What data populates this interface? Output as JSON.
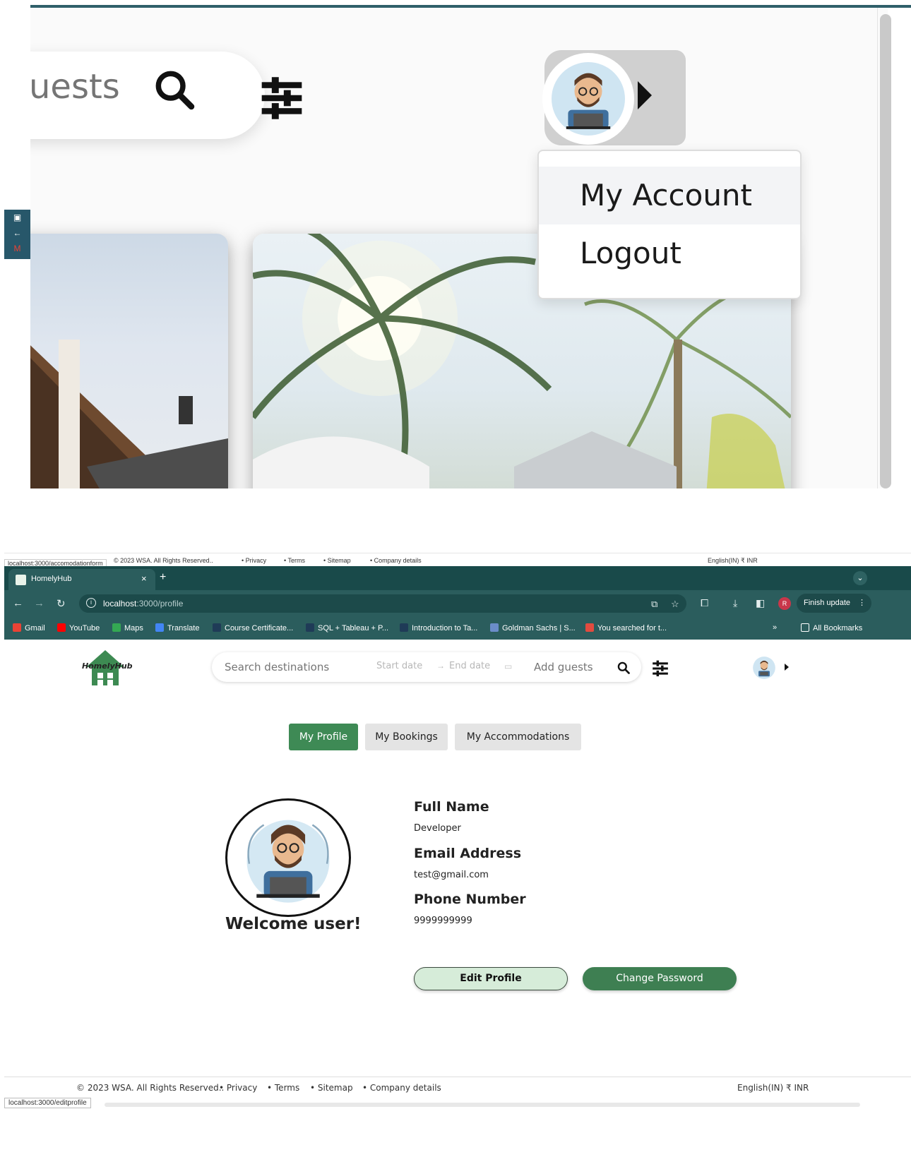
{
  "zoom": {
    "search_partial": "uests",
    "menu": {
      "items": [
        "My Account",
        "Logout"
      ]
    }
  },
  "ghost_footer": {
    "copyright": "© 2023 WSA. All Rights Reserved..",
    "links": [
      "• Privacy",
      "• Terms",
      "• Sitemap",
      "• Company details"
    ],
    "locale": "English(IN) ₹ INR",
    "url_hint": "localhost:3000/accomodationform"
  },
  "browser": {
    "tab_title": "HomelyHub",
    "tab_close": "×",
    "new_tab": "+",
    "url_host": "localhost",
    "url_path": ":3000/profile",
    "finish_update": "Finish update",
    "profile_initial": "R",
    "bookmarks": [
      {
        "label": "Gmail",
        "color": "#ea4335"
      },
      {
        "label": "YouTube",
        "color": "#ff0000"
      },
      {
        "label": "Maps",
        "color": "#34a853"
      },
      {
        "label": "Translate",
        "color": "#4285f4"
      },
      {
        "label": "Course Certificate...",
        "color": "#1f3b57"
      },
      {
        "label": "SQL + Tableau + P...",
        "color": "#1f3b57"
      },
      {
        "label": "Introduction to Ta...",
        "color": "#1f3b57"
      },
      {
        "label": "Goldman Sachs | S...",
        "color": "#6b8dc9"
      },
      {
        "label": "You searched for t...",
        "color": "#e24b3f"
      }
    ],
    "more_bookmarks": "»",
    "all_bookmarks": "All Bookmarks"
  },
  "app": {
    "logo_text": "HomelyHub",
    "search": {
      "destination_placeholder": "Search destinations",
      "start_placeholder": "Start date",
      "arrow": "→",
      "end_placeholder": "End date",
      "guests_placeholder": "Add guests"
    },
    "tabs": [
      "My Profile",
      "My Bookings",
      "My Accommodations"
    ],
    "active_tab": "My Profile",
    "welcome": "Welcome user!",
    "fields": [
      {
        "label": "Full Name",
        "value": "Developer"
      },
      {
        "label": "Email Address",
        "value": "test@gmail.com"
      },
      {
        "label": "Phone Number",
        "value": "9999999999"
      }
    ],
    "buttons": {
      "edit": "Edit Profile",
      "change_password": "Change Password"
    }
  },
  "footer": {
    "copyright": "© 2023 WSA. All Rights Reserved..",
    "links": [
      "• Privacy",
      "• Terms",
      "• Sitemap",
      "• Company details"
    ],
    "locale": "English(IN) ₹ INR",
    "url_hint": "localhost:3000/editprofile"
  },
  "colors": {
    "chrome": "#194a4a",
    "brand_green": "#3e8a55"
  }
}
